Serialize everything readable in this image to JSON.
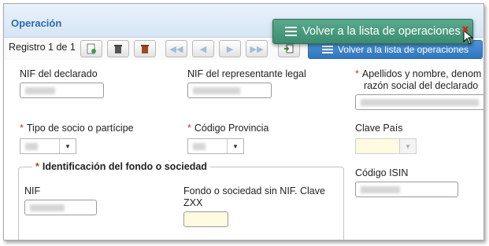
{
  "section": {
    "title": "Operación"
  },
  "toolbar": {
    "record_label": "Registro 1 de 1",
    "list_button_small_label": "Volver a la lista de operaciones"
  },
  "tooltip_button": {
    "label": "Volver a la lista de operaciones"
  },
  "fields": {
    "nif_declarado": {
      "label": "NIF del declarado"
    },
    "nif_representante": {
      "label": "NIF del representante legal"
    },
    "apellidos": {
      "label_line1": "Apellidos y nombre, denom",
      "label_line2": "razón social del declarado"
    },
    "tipo_socio": {
      "label": "Tipo de socio o partícipe"
    },
    "codigo_provincia": {
      "label": "Código Provincia"
    },
    "clave_pais": {
      "label": "Clave País"
    },
    "identificacion": {
      "legend": "Identificación del fondo o sociedad"
    },
    "nif": {
      "label": "NIF"
    },
    "fondo": {
      "label_line1": "Fondo o sociedad sin NIF. Clave",
      "label_line2": "ZXX"
    },
    "codigo_isin": {
      "label": "Código ISIN"
    }
  },
  "colors": {
    "accent_blue": "#2f76bf",
    "accent_green": "#3b8c70",
    "required": "#c0392b"
  }
}
